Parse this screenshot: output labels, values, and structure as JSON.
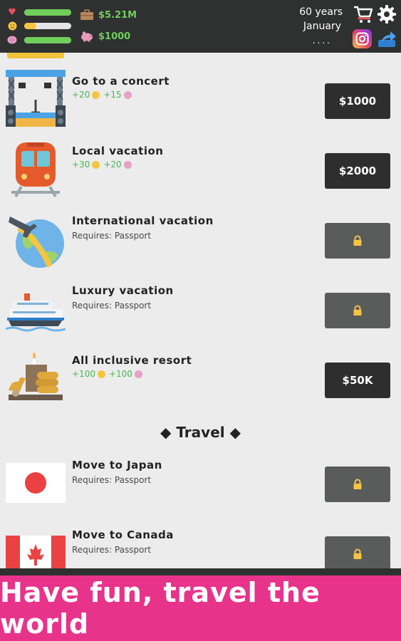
{
  "stats": {
    "health_icon": "heart-icon",
    "happiness_icon": "smiley-icon",
    "smarts_icon": "brain-icon",
    "health_level": 1.0,
    "happiness_level": 0.25,
    "smarts_level": 1.0,
    "health_color": "#6fcf5a",
    "happiness_color": "#f5c542",
    "smarts_color": "#6fcf5a"
  },
  "money": {
    "cash": "$5.21M",
    "savings": "$1000"
  },
  "time": {
    "age": "60 years",
    "month": "January",
    "dots": "...."
  },
  "items": [
    {
      "title": "Go to a concert",
      "happy": "+20",
      "smart": "+15",
      "button": "$1000",
      "locked": false
    },
    {
      "title": "Local vacation",
      "happy": "+30",
      "smart": "+20",
      "button": "$2000",
      "locked": false
    },
    {
      "title": "International vacation",
      "requires": "Requires: Passport",
      "locked": true
    },
    {
      "title": "Luxury vacation",
      "requires": "Requires: Passport",
      "locked": true
    },
    {
      "title": "All inclusive resort",
      "happy": "+100",
      "smart": "+100",
      "button": "$50K",
      "locked": false
    }
  ],
  "section_title": "◆ Travel ◆",
  "travel": [
    {
      "title": "Move to Japan",
      "requires": "Requires: Passport",
      "locked": true
    },
    {
      "title": "Move to Canada",
      "requires": "Requires: Passport",
      "locked": true
    }
  ],
  "banner": "Have fun, travel the world"
}
